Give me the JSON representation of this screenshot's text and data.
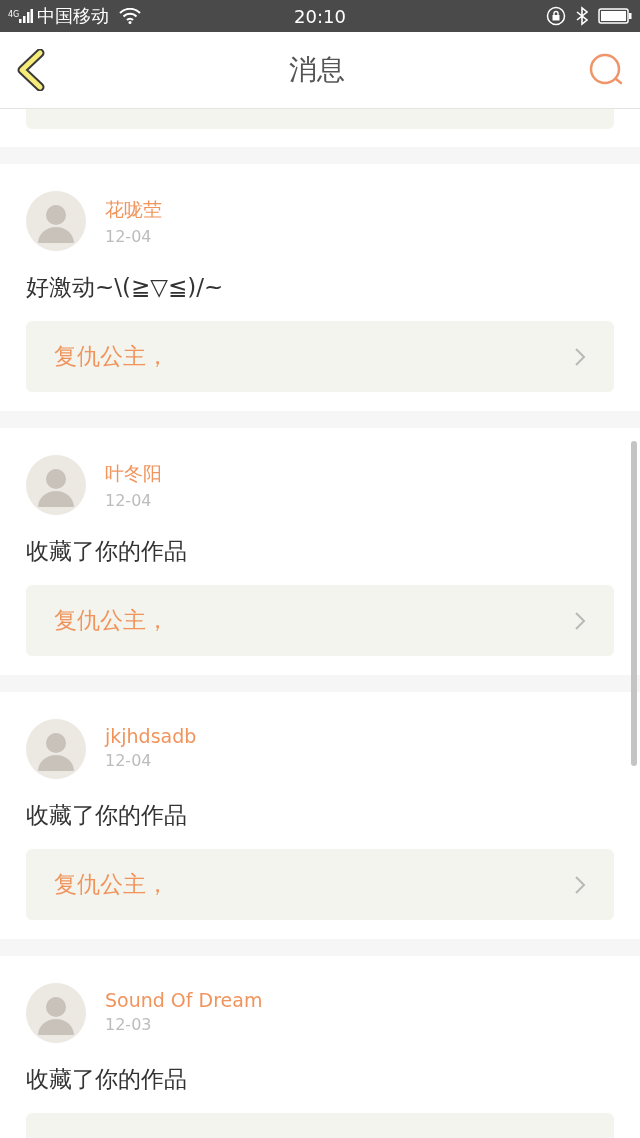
{
  "status_bar": {
    "network": "4G",
    "carrier": "中国移动",
    "time": "20:10"
  },
  "header": {
    "title": "消息"
  },
  "messages": [
    {
      "name": "花咙茔",
      "date": "12-04",
      "text": "好激动~\\(≧▽≦)/~",
      "work": "复仇公主，"
    },
    {
      "name": "叶冬阳",
      "date": "12-04",
      "text": "收藏了你的作品",
      "work": "复仇公主，"
    },
    {
      "name": "jkjhdsadb",
      "date": "12-04",
      "text": "收藏了你的作品",
      "work": "复仇公主，"
    },
    {
      "name": "Sound Of Dream",
      "date": "12-03",
      "text": "收藏了你的作品"
    }
  ]
}
